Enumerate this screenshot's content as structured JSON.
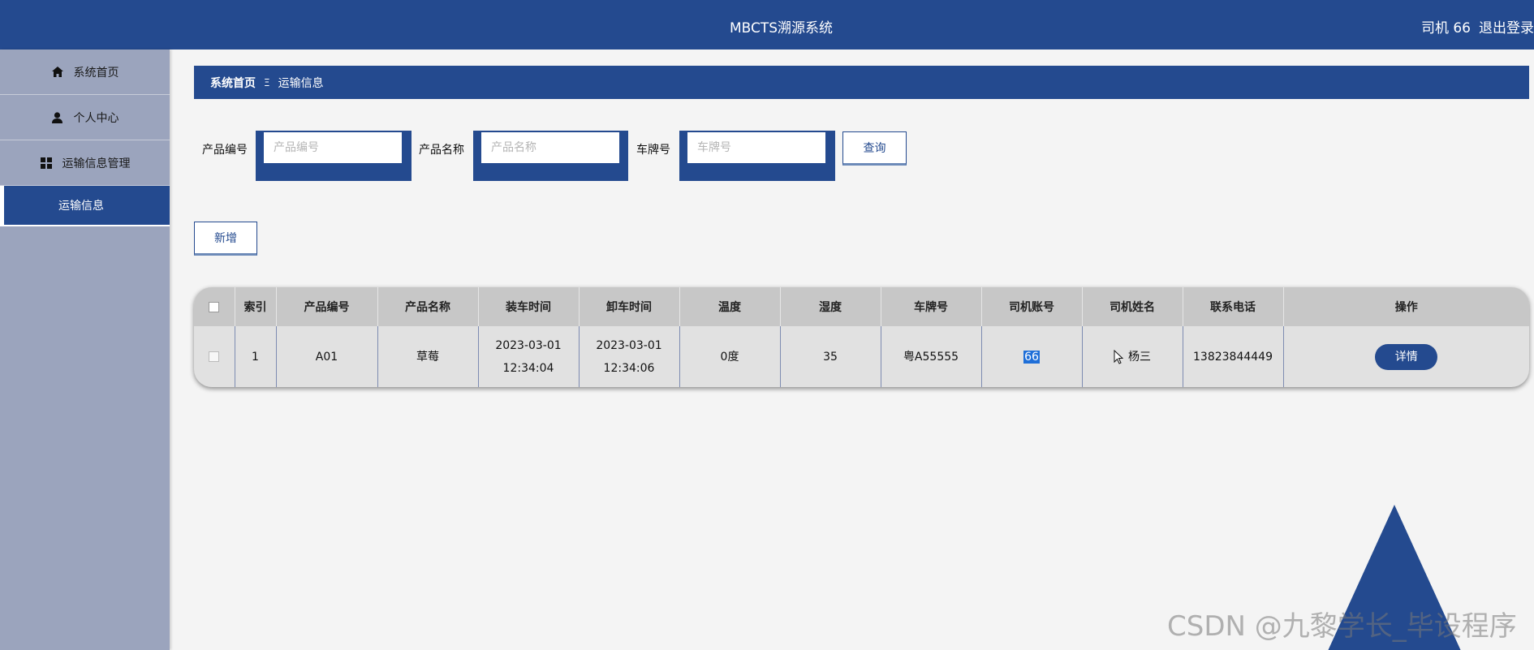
{
  "header": {
    "title": "MBCTS溯源系统",
    "user_label": "司机 66",
    "logout_label": "退出登录"
  },
  "sidebar": {
    "items": [
      {
        "label": "系统首页",
        "icon": "home-icon"
      },
      {
        "label": "个人中心",
        "icon": "user-icon"
      },
      {
        "label": "运输信息管理",
        "icon": "grid-icon"
      }
    ],
    "sub_items": [
      {
        "label": "运输信息",
        "active": true
      }
    ]
  },
  "breadcrumb": {
    "home": "系统首页",
    "separator": "Ξ",
    "current": "运输信息"
  },
  "search": {
    "product_code_label": "产品编号",
    "product_code_placeholder": "产品编号",
    "product_name_label": "产品名称",
    "product_name_placeholder": "产品名称",
    "plate_label": "车牌号",
    "plate_placeholder": "车牌号",
    "query_label": "查询"
  },
  "actions": {
    "add_label": "新增"
  },
  "table": {
    "columns": [
      "索引",
      "产品编号",
      "产品名称",
      "装车时间",
      "卸车时间",
      "温度",
      "湿度",
      "车牌号",
      "司机账号",
      "司机姓名",
      "联系电话",
      "操作"
    ],
    "rows": [
      {
        "index": "1",
        "product_code": "A01",
        "product_name": "草莓",
        "load_time": "2023-03-01 12:34:04",
        "unload_time": "2023-03-01 12:34:06",
        "temperature": "0度",
        "humidity": "35",
        "plate": "粤A55555",
        "driver_account": "66",
        "driver_name": "杨三",
        "phone": "13823844449",
        "action_label": "详情"
      }
    ]
  },
  "watermark": "CSDN @九黎学长_毕设程序",
  "colors": {
    "primary": "#244a8f",
    "sidebar": "#9ba4bd",
    "background": "#f4f4f4",
    "table_header": "#c7c7c7"
  }
}
